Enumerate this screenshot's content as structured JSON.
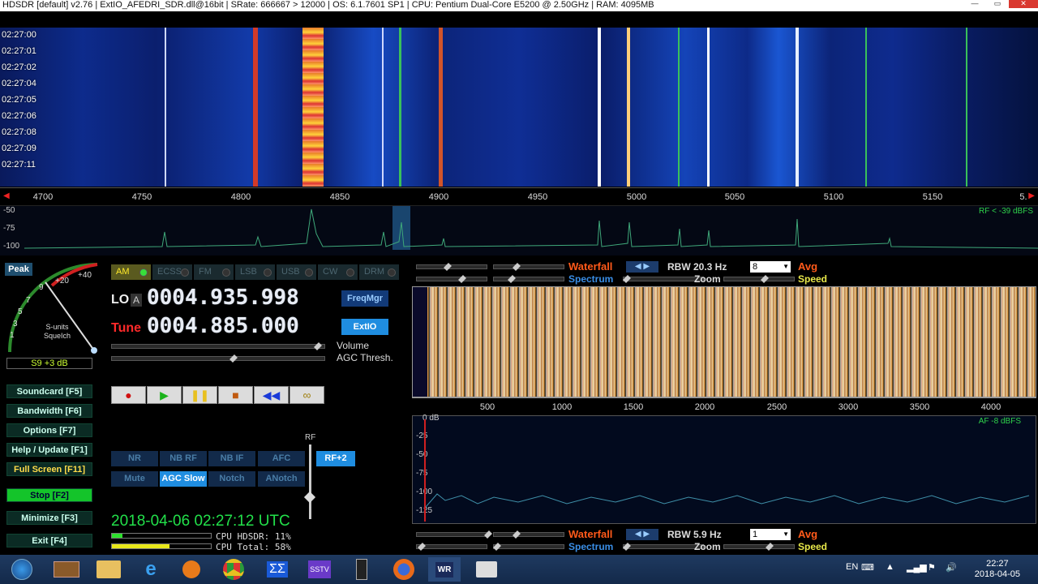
{
  "title": "HDSDR  [default]  v2.76    |  ExtIO_AFEDRI_SDR.dll@16bit  |  SRate: 666667 > 12000  |  OS: 6.1.7601 SP1  |  CPU: Pentium Dual-Core        E5200  @ 2.50GHz  |  RAM: 4095MB",
  "waterfall_times": [
    "02:27:00",
    "02:27:01",
    "02:27:02",
    "02:27:04",
    "02:27:05",
    "02:27:06",
    "02:27:08",
    "02:27:09",
    "02:27:11"
  ],
  "freq_axis": [
    "4700",
    "4750",
    "4800",
    "4850",
    "4900",
    "4950",
    "5000",
    "5050",
    "5100",
    "5150",
    "5."
  ],
  "spectrum_top": {
    "ticks": [
      "-50",
      "-75",
      "-100"
    ],
    "rf_label": "RF < -39 dBFS"
  },
  "peak_label": "Peak",
  "smeter": {
    "scale": [
      "+20",
      "+40",
      "9",
      "7",
      "5",
      "3",
      "1"
    ],
    "label": "S-units\nSqueIch",
    "reading": "S9 +3 dB"
  },
  "side_buttons": [
    "Soundcard  [F5]",
    "Bandwidth  [F6]",
    "Options  [F7]",
    "Help / Update  [F1]",
    "Full Screen  [F11]",
    "Stop        [F2]",
    "Minimize  [F3]",
    "Exit        [F4]"
  ],
  "modes": [
    "AM",
    "ECSS",
    "FM",
    "LSB",
    "USB",
    "CW",
    "DRM"
  ],
  "lo": {
    "label": "LO",
    "badge": "A",
    "value": "0004.935.998"
  },
  "tune": {
    "label": "Tune",
    "value": "0004.885.000"
  },
  "freqmgr": "FreqMgr",
  "extio": "ExtIO",
  "volume_label": "Volume",
  "agc_label": "AGC Thresh.",
  "dsp_row1": [
    "NR",
    "NB RF",
    "NB IF",
    "AFC"
  ],
  "dsp_row2": [
    "Mute",
    "AGC Slow",
    "Notch",
    "ANotch"
  ],
  "rf_label": "RF",
  "rf_btn": "RF+2",
  "datetime": "2018-04-06   02:27:12 UTC",
  "cpu_hdsdr": "CPU HDSDR:  11%",
  "cpu_total": "CPU Total:  58%",
  "audio_top": {
    "waterfall": "Waterfall",
    "spectrum": "Spectrum",
    "rbw": "RBW 20.3 Hz",
    "sel": "8",
    "avg": "Avg",
    "zoom": "Zoom",
    "speed": "Speed"
  },
  "audio_axis": [
    "500",
    "1000",
    "1500",
    "2000",
    "2500",
    "3000",
    "3500",
    "4000"
  ],
  "af_ticks": [
    "0 dB",
    "-25",
    "-50",
    "-75",
    "-100",
    "-125"
  ],
  "af_label": "AF  -8 dBFS",
  "audio_bot": {
    "waterfall": "Waterfall",
    "spectrum": "Spectrum",
    "rbw": "RBW  5.9 Hz",
    "sel": "1",
    "avg": "Avg",
    "zoom": "Zoom",
    "speed": "Speed"
  },
  "tray": {
    "lang": "EN",
    "time": "22:27",
    "date": "2018-04-05"
  }
}
